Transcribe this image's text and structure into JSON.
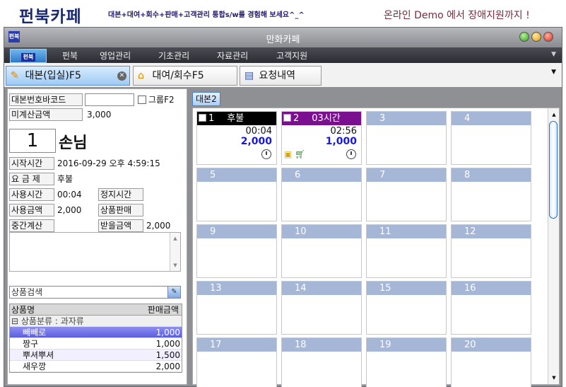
{
  "banner": {
    "logo": "펀북카페",
    "slogan": "대본+대여+회수+판매+고객관리 통합s/w를 경험해 보세요^_^",
    "demo": "온라인 Demo 에서 장애지원까지 !"
  },
  "window": {
    "title": "만화카페",
    "app_icon": "펀북"
  },
  "menu": {
    "logo_tab": "펀북",
    "items": [
      "펀북",
      "영업관리",
      "기초관리",
      "자료관리",
      "고객지원"
    ]
  },
  "tabs": [
    {
      "label": "대본(입실)F5",
      "icon": "pencil-icon",
      "active": true
    },
    {
      "label": "대여/회수F5",
      "icon": "home-icon",
      "active": false
    },
    {
      "label": "요청내역",
      "icon": "document-icon",
      "active": false
    }
  ],
  "left": {
    "barcode_label": "대본번호바코드",
    "barcode_value": "",
    "group_label": "그룹F2",
    "unpaid_label": "미계산금액",
    "unpaid_value": "3,000",
    "seat_number": "1",
    "guest": "손님",
    "start_label": "시작시간",
    "start_value": "2016-09-29 오후 4:59:15",
    "plan_label": "요 금 제",
    "plan_value": "후불",
    "usetime_label": "사용시간",
    "usetime_value": "00:04",
    "stop_label": "정지시간",
    "useamt_label": "사용금액",
    "useamt_value": "2,000",
    "goods_label": "상품판매",
    "mid_label": "중간계산",
    "receive_label": "받을금액",
    "receive_value": "2,000",
    "search_placeholder": "상품검색",
    "table": {
      "col_name": "상품명",
      "col_price": "판매금액",
      "category": "상품분류 : 과자류",
      "rows": [
        {
          "name": "빼빼로",
          "price": "1,000"
        },
        {
          "name": "짱구",
          "price": "1,000"
        },
        {
          "name": "뿌셔뿌셔",
          "price": "1,500"
        },
        {
          "name": "새우깡",
          "price": "2,000"
        }
      ]
    }
  },
  "right": {
    "subtab": "대본2",
    "seats": [
      {
        "num": "1",
        "label": "후불",
        "time": "00:04",
        "amount": "2,000"
      },
      {
        "num": "2",
        "label": "03시간",
        "time": "02:56",
        "amount": "1,000"
      },
      {
        "num": "3"
      },
      {
        "num": "4"
      },
      {
        "num": "5"
      },
      {
        "num": "6"
      },
      {
        "num": "7"
      },
      {
        "num": "8"
      },
      {
        "num": "9"
      },
      {
        "num": "10"
      },
      {
        "num": "11"
      },
      {
        "num": "12"
      },
      {
        "num": "13"
      },
      {
        "num": "14"
      },
      {
        "num": "15"
      },
      {
        "num": "16"
      },
      {
        "num": "17"
      },
      {
        "num": "18"
      },
      {
        "num": "19"
      },
      {
        "num": "20"
      }
    ]
  }
}
